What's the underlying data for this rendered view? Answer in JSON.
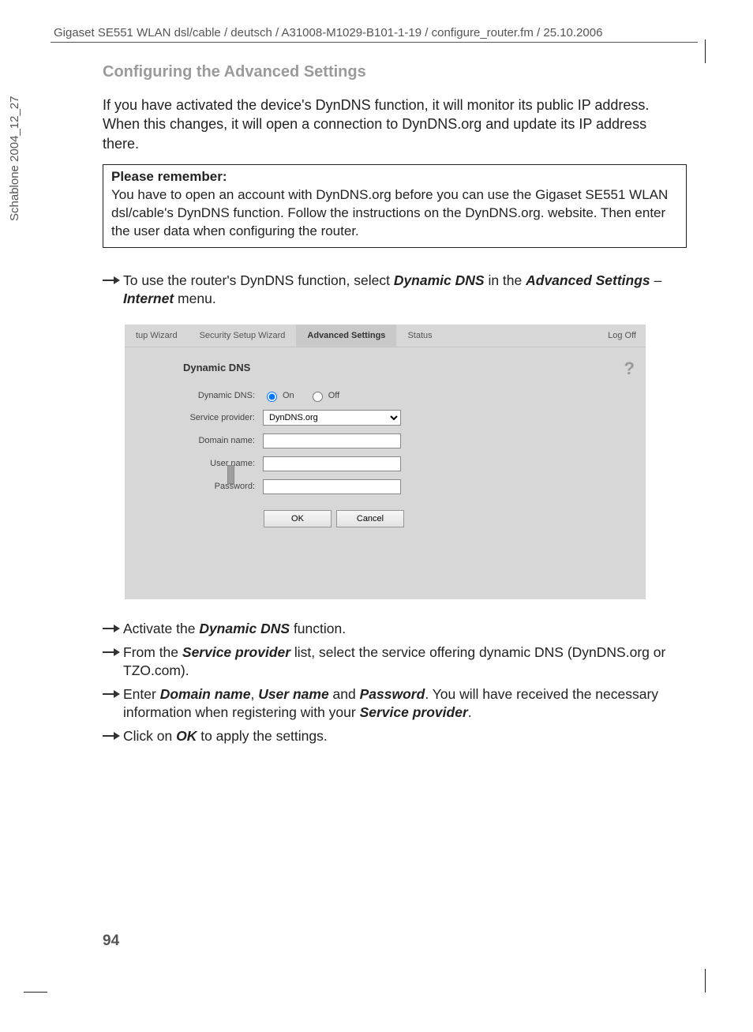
{
  "header": "Gigaset SE551 WLAN dsl/cable / deutsch / A31008-M1029-B101-1-19 / configure_router.fm / 25.10.2006",
  "side": "Schablone 2004_12_27",
  "page_number": "94",
  "title": "Configuring the Advanced Settings",
  "intro": "If you have activated the device's DynDNS function, it will monitor its public IP address. When this changes, it will open a connection to DynDNS.org and update its IP address there.",
  "note": {
    "title": "Please remember:",
    "body": "You have to open an account with DynDNS.org before you can use the Gigaset SE551 WLAN dsl/cable's DynDNS function. Follow the instructions on the DynDNS.org. website. Then enter the user data when configuring the router."
  },
  "step1": {
    "pre": "To use the router's DynDNS function, select ",
    "b1": "Dynamic DNS",
    "mid1": " in the ",
    "b2": "Advanced Settings",
    "mid2": " – ",
    "b3": "Internet",
    "post": " menu."
  },
  "screenshot": {
    "nav": {
      "wizard": "tup Wizard",
      "security": "Security Setup Wizard",
      "advanced": "Advanced Settings",
      "status": "Status",
      "logoff": "Log Off"
    },
    "panel_title": "Dynamic DNS",
    "help": "?",
    "labels": {
      "ddns": "Dynamic DNS:",
      "provider": "Service provider:",
      "domain": "Domain name:",
      "user": "User name:",
      "pass": "Password:"
    },
    "radio_on": "On",
    "radio_off": "Off",
    "provider_value": "DynDNS.org",
    "ok": "OK",
    "cancel": "Cancel"
  },
  "step2": {
    "pre": "Activate the ",
    "b": "Dynamic DNS",
    "post": " function."
  },
  "step3": {
    "pre": "From the ",
    "b": "Service provider",
    "post": " list, select the service offering dynamic DNS (DynDNS.org or TZO.com)."
  },
  "step4": {
    "pre": "Enter ",
    "b1": "Domain name",
    "c1": ", ",
    "b2": "User name",
    "c2": " and ",
    "b3": "Password",
    "mid": ". You will have received the necessary information when registering with your ",
    "b4": "Service provider",
    "post": "."
  },
  "step5": {
    "pre": "Click on ",
    "b": "OK",
    "post": " to apply the settings."
  }
}
